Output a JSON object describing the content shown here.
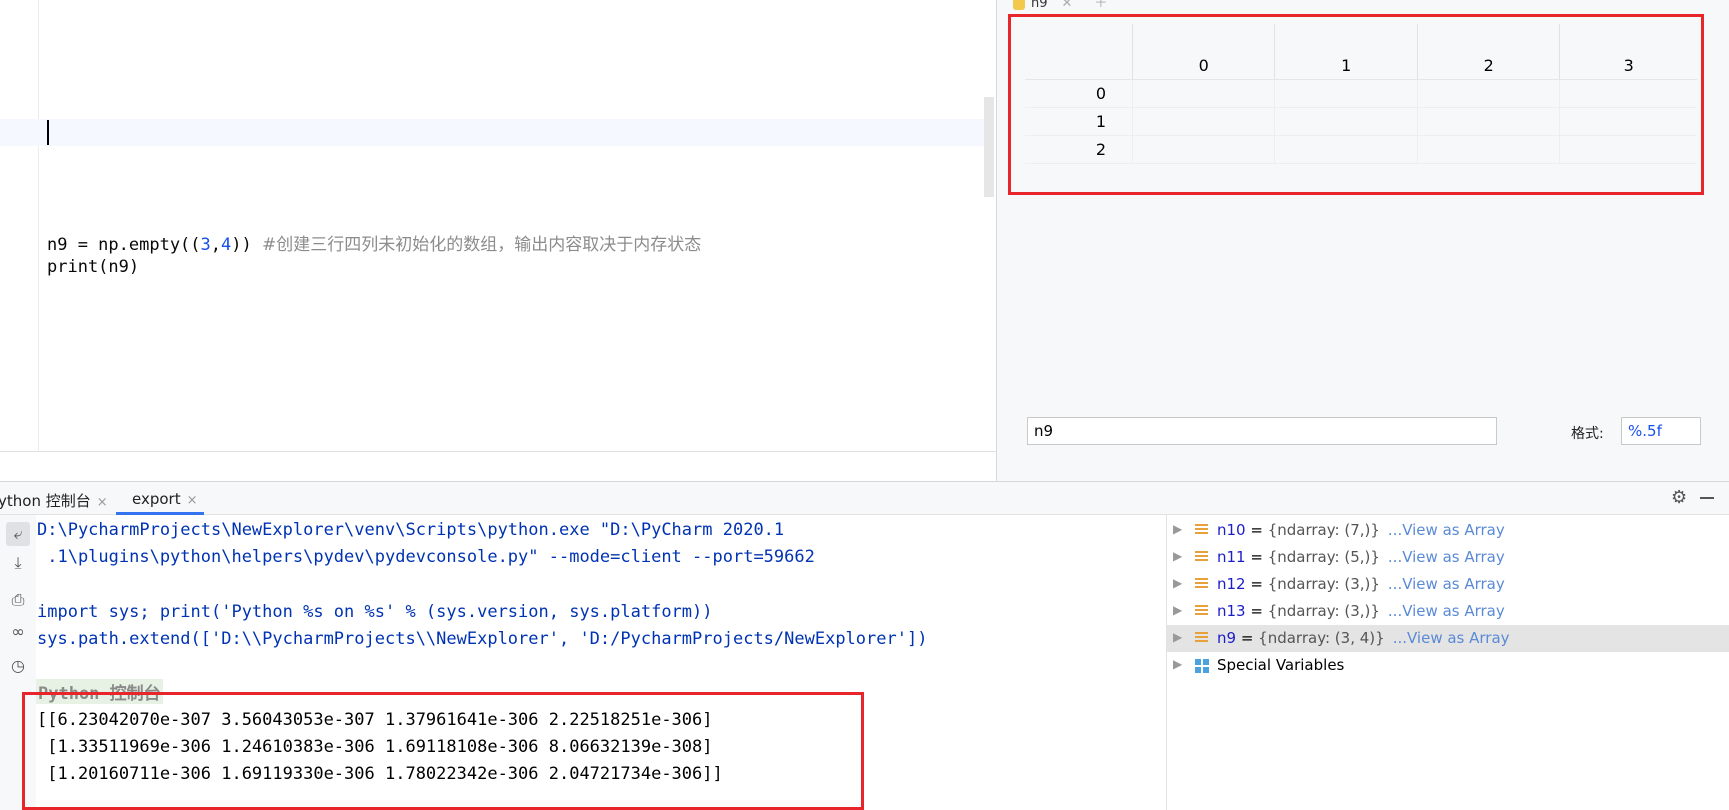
{
  "editor": {
    "code_line1_a": "n9 = np.empty((",
    "code_line1_n1": "3",
    "code_line1_sep": ",",
    "code_line1_n2": "4",
    "code_line1_b": ")) ",
    "code_line1_comment": "#创建三行四列未初始化的数组，输出内容取决于内存状态",
    "code_line2": "print(n9)"
  },
  "array_view": {
    "tab_label": "n9",
    "column_headers": [
      "0",
      "1",
      "2",
      "3"
    ],
    "row_headers": [
      "0",
      "1",
      "2"
    ],
    "slice_value": "n9",
    "format_label": "格式:",
    "format_value": "%.5f"
  },
  "tool_window": {
    "tabs": [
      {
        "label": "ython 控制台",
        "close": "×"
      },
      {
        "label": "export",
        "close": "×"
      }
    ]
  },
  "console": {
    "lines": [
      "D:\\PycharmProjects\\NewExplorer\\venv\\Scripts\\python.exe \"D:\\PyCharm 2020.1",
      " .1\\plugins\\python\\helpers\\pydev\\pydevconsole.py\" --mode=client --port=59662",
      "",
      "import sys; print('Python %s on %s' % (sys.version, sys.platform))",
      "sys.path.extend(['D:\\\\PycharmProjects\\\\NewExplorer', 'D:/PycharmProjects/NewExplorer'])"
    ],
    "prompt": "Python 控制台",
    "output": [
      "[[6.23042070e-307 3.56043053e-307 1.37961641e-306 2.22518251e-306]",
      " [1.33511969e-306 1.24610383e-306 1.69118108e-306 8.06632139e-308]",
      " [1.20160711e-306 1.69119330e-306 1.78022342e-306 2.04721734e-306]]"
    ]
  },
  "variables": {
    "items": [
      {
        "name": "n10",
        "eq": " = ",
        "type": "{ndarray: (7,)}",
        "link": "...View as Array"
      },
      {
        "name": "n11",
        "eq": " = ",
        "type": "{ndarray: (5,)}",
        "link": "...View as Array"
      },
      {
        "name": "n12",
        "eq": " = ",
        "type": "{ndarray: (3,)}",
        "link": "...View as Array"
      },
      {
        "name": "n13",
        "eq": " = ",
        "type": "{ndarray: (3,)}",
        "link": "...View as Array"
      },
      {
        "name": "n9",
        "eq": " = ",
        "type": "{ndarray: (3, 4)}",
        "link": "...View as Array"
      }
    ],
    "special": "Special Variables"
  },
  "colors": {
    "highlight_box": "#e8252a",
    "keyword_blue": "#0033b3",
    "link_blue": "#5a8ad6"
  }
}
